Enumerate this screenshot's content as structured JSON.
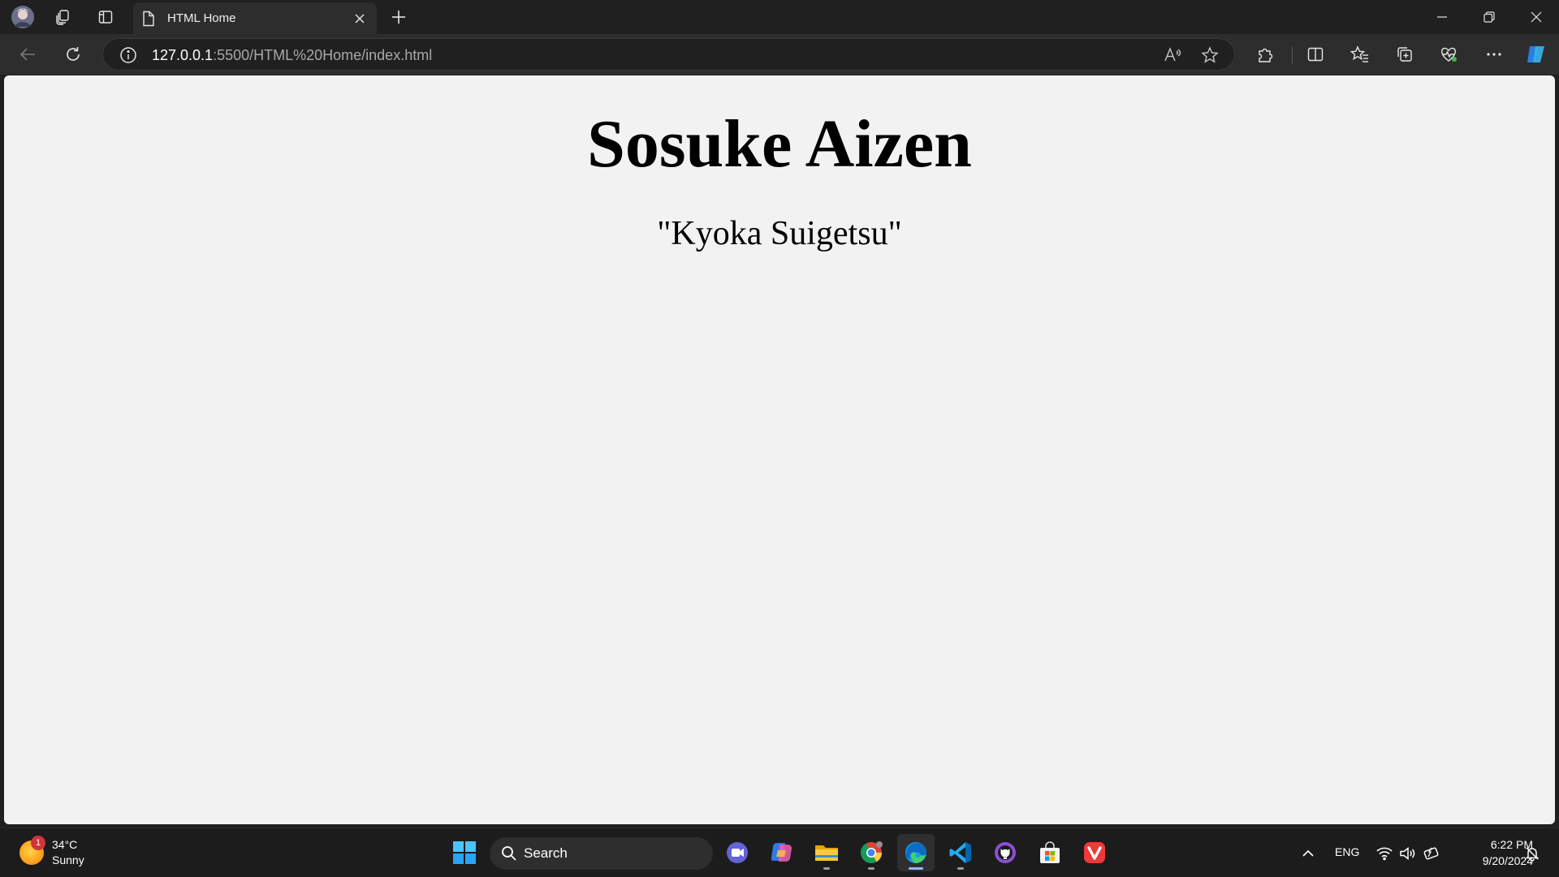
{
  "browser": {
    "tab": {
      "title": "HTML Home"
    },
    "address_bar": {
      "host": "127.0.0.1",
      "path": ":5500/HTML%20Home/index.html"
    }
  },
  "page": {
    "heading": "Sosuke Aizen",
    "quote": "\"Kyoka Suigetsu\""
  },
  "taskbar": {
    "weather": {
      "temperature": "34°C",
      "condition": "Sunny",
      "badge": "1"
    },
    "search_label": "Search",
    "language": "ENG",
    "time": "6:22 PM",
    "date": "9/20/2024"
  },
  "colors": {
    "page_background": "#f2f2f2",
    "browser_chrome": "#2d2d2d",
    "taskbar": "#1c1c1c"
  }
}
